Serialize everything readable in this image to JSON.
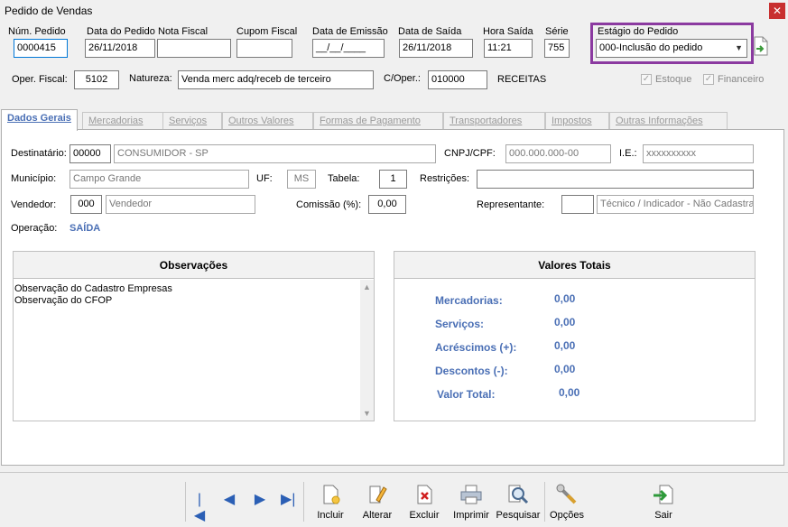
{
  "window": {
    "title": "Pedido de Vendas",
    "close_glyph": "✕"
  },
  "header": {
    "num_pedido_label": "Núm. Pedido",
    "num_pedido": "0000415",
    "data_pedido_label": "Data do Pedido",
    "data_pedido": "26/11/2018",
    "nota_fiscal_label": "Nota Fiscal",
    "nota_fiscal": "",
    "cupom_fiscal_label": "Cupom Fiscal",
    "cupom_fiscal": "",
    "data_emissao_label": "Data de Emissão",
    "data_emissao": "__/__/____",
    "data_saida_label": "Data de Saída",
    "data_saida": "26/11/2018",
    "hora_saida_label": "Hora Saída",
    "hora_saida": "11:21",
    "serie_label": "Série",
    "serie": "755",
    "estagio_label": "Estágio do Pedido",
    "estagio": "000-Inclusão do pedido",
    "oper_fiscal_label": "Oper. Fiscal:",
    "oper_fiscal": "5102",
    "natureza_label": "Natureza:",
    "natureza": "Venda merc adq/receb de terceiro",
    "c_oper_label": "C/Oper.:",
    "c_oper": "010000",
    "receitas": "RECEITAS",
    "estoque_label": "Estoque",
    "financeiro_label": "Financeiro"
  },
  "tabs": [
    "Dados Gerais",
    "Mercadorias",
    "Serviços",
    "Outros Valores",
    "Formas de Pagamento",
    "Transportadores",
    "Impostos",
    "Outras Informações"
  ],
  "dados": {
    "destinatario_label": "Destinatário:",
    "destinatario_cod": "00000",
    "destinatario_nome": "CONSUMIDOR - SP",
    "cnpj_label": "CNPJ/CPF:",
    "cnpj": "000.000.000-00",
    "ie_label": "I.E.:",
    "ie": "xxxxxxxxxx",
    "municipio_label": "Município:",
    "municipio": "Campo Grande",
    "uf_label": "UF:",
    "uf": "MS",
    "tabela_label": "Tabela:",
    "tabela": "1",
    "restricoes_label": "Restrições:",
    "restricoes": "",
    "vendedor_label": "Vendedor:",
    "vendedor_cod": "000",
    "vendedor_nome": "Vendedor",
    "comissao_label": "Comissão (%):",
    "comissao": "0,00",
    "representante_label": "Representante:",
    "representante_cod": "",
    "representante_nome": "Técnico / Indicador - Não Cadastra",
    "operacao_label": "Operação:",
    "operacao": "SAÍDA"
  },
  "observacoes": {
    "title": "Observações",
    "lines": [
      "Observação do Cadastro Empresas",
      "Observação do CFOP"
    ]
  },
  "totais": {
    "title": "Valores Totais",
    "mercadorias_label": "Mercadorias:",
    "mercadorias": "0,00",
    "servicos_label": "Serviços:",
    "servicos": "0,00",
    "acrescimos_label": "Acréscimos (+):",
    "acrescimos": "0,00",
    "descontos_label": "Descontos (-):",
    "descontos": "0,00",
    "total_label": "Valor Total:",
    "total": "0,00"
  },
  "toolbar": {
    "nav": [
      "|◀",
      "◀",
      "▶",
      "▶|"
    ],
    "incluir": "Incluir",
    "alterar": "Alterar",
    "excluir": "Excluir",
    "imprimir": "Imprimir",
    "pesquisar": "Pesquisar",
    "opcoes": "Opções",
    "sair": "Sair"
  }
}
